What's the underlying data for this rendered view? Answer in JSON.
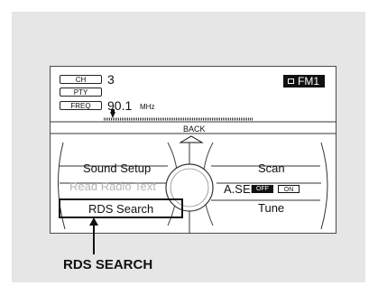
{
  "display": {
    "labels": {
      "ch": "CH",
      "pty": "PTY",
      "freq": "FREQ"
    },
    "channel": "3",
    "frequency": "90.1",
    "frequency_unit": "MHz",
    "band": "FM1"
  },
  "controls": {
    "back": "BACK",
    "sound_setup": "Sound Setup",
    "read_radio_text": "Read Radio Text",
    "rds_search": "RDS Search",
    "scan": "Scan",
    "a_sel": "A.SEL",
    "a_sel_off": "OFF",
    "a_sel_on": "ON",
    "tune": "Tune"
  },
  "callout": {
    "label": "RDS SEARCH"
  },
  "colors": {
    "panel": "#e6e6e6",
    "ink": "#111111",
    "dimmed": "#b5b5b5"
  },
  "icons": {
    "band_badge": "display-icon",
    "back": "triangle-up-icon",
    "callout": "arrow-up-icon"
  }
}
